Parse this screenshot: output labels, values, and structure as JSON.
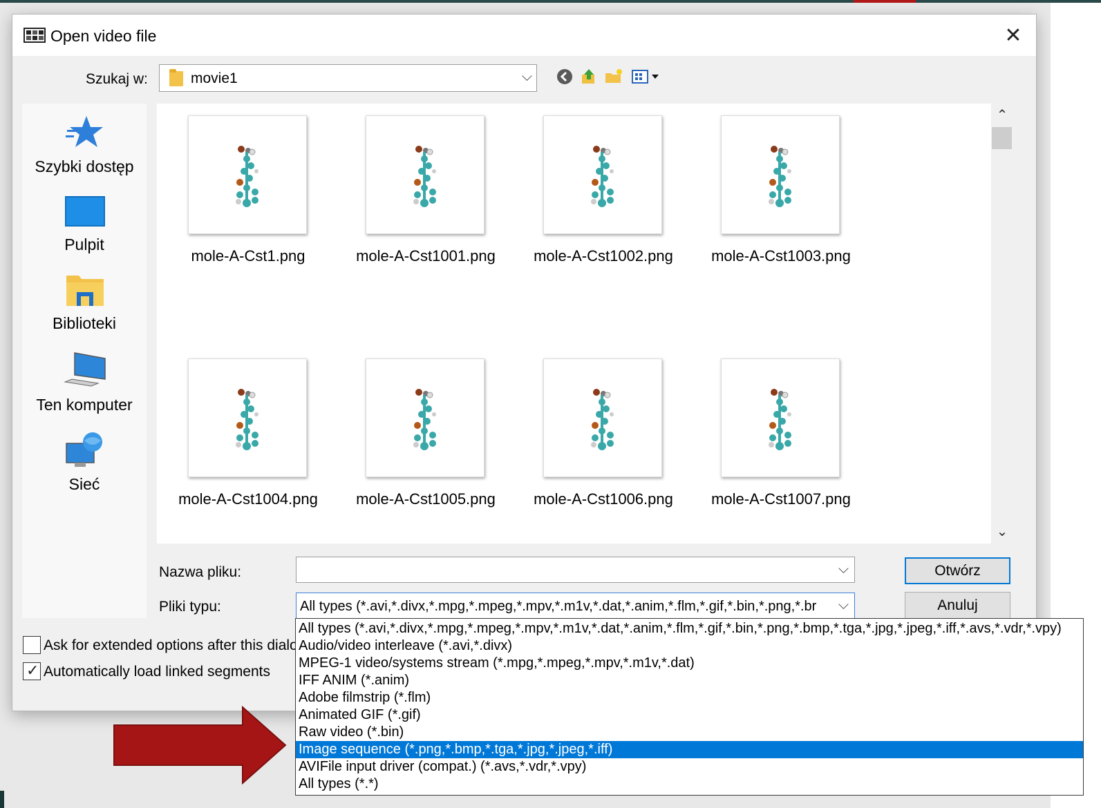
{
  "dialog": {
    "title": "Open video file",
    "close_glyph": "✕"
  },
  "lookin": {
    "label": "Szukaj w:",
    "value": "movie1"
  },
  "toolbar": {
    "icons": [
      "back-icon",
      "up-folder-icon",
      "new-folder-icon",
      "view-menu-icon"
    ]
  },
  "places": [
    {
      "label": "Szybki dostęp",
      "icon": "star-icon"
    },
    {
      "label": "Pulpit",
      "icon": "desktop-icon"
    },
    {
      "label": "Biblioteki",
      "icon": "libraries-icon"
    },
    {
      "label": "Ten komputer",
      "icon": "computer-icon"
    },
    {
      "label": "Sieć",
      "icon": "network-icon"
    }
  ],
  "files": [
    "mole-A-Cst1.png",
    "mole-A-Cst1001.png",
    "mole-A-Cst1002.png",
    "mole-A-Cst1003.png",
    "mole-A-Cst1004.png",
    "mole-A-Cst1005.png",
    "mole-A-Cst1006.png",
    "mole-A-Cst1007.png"
  ],
  "filename": {
    "label": "Nazwa pliku:",
    "value": ""
  },
  "filetype": {
    "label": "Pliki typu:",
    "value": "All types (*.avi,*.divx,*.mpg,*.mpeg,*.mpv,*.m1v,*.dat,*.anim,*.flm,*.gif,*.bin,*.png,*.br"
  },
  "buttons": {
    "open": "Otwórz",
    "cancel": "Anuluj"
  },
  "options": {
    "extended": {
      "label": "Ask for extended options after this dialog",
      "checked": false
    },
    "linked": {
      "label": "Automatically load linked segments",
      "checked": true
    }
  },
  "dropdown": {
    "items": [
      "All types (*.avi,*.divx,*.mpg,*.mpeg,*.mpv,*.m1v,*.dat,*.anim,*.flm,*.gif,*.bin,*.png,*.bmp,*.tga,*.jpg,*.jpeg,*.iff,*.avs,*.vdr,*.vpy)",
      "Audio/video interleave (*.avi,*.divx)",
      "MPEG-1 video/systems stream (*.mpg,*.mpeg,*.mpv,*.m1v,*.dat)",
      "IFF ANIM (*.anim)",
      "Adobe filmstrip (*.flm)",
      "Animated GIF (*.gif)",
      "Raw video (*.bin)",
      "Image sequence (*.png,*.bmp,*.tga,*.jpg,*.jpeg,*.iff)",
      "AVIFile input driver (compat.) (*.avs,*.vdr,*.vpy)",
      "All types (*.*)"
    ],
    "selected": "Image sequence (*.png,*.bmp,*.tga,*.jpg,*.jpeg,*.iff)"
  },
  "colors": {
    "accent": "#0078d7",
    "annotation_arrow": "#a61515"
  }
}
